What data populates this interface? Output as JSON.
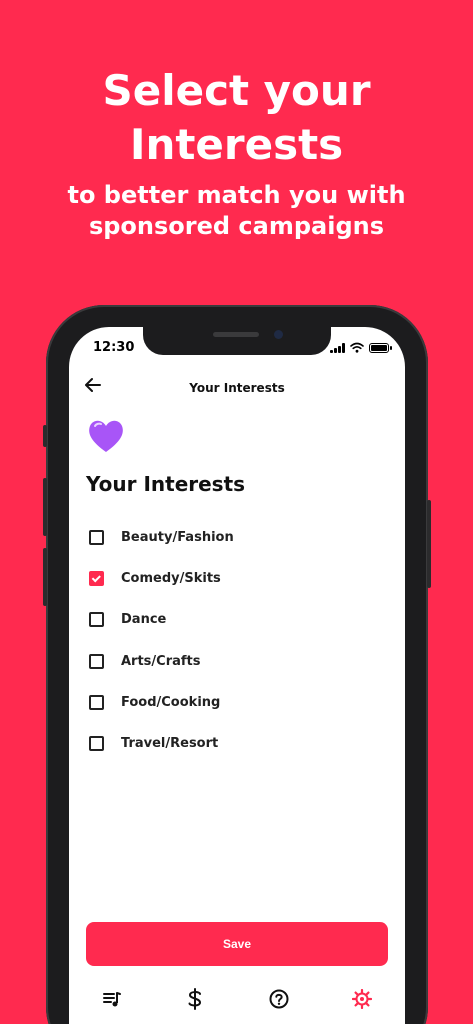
{
  "promo": {
    "title_line1": "Select your",
    "title_line2": "Interests",
    "subtitle_line1": "to better match you with",
    "subtitle_line2": "sponsored campaigns"
  },
  "status_bar": {
    "time": "12:30"
  },
  "nav": {
    "back_icon": "arrow-left-icon",
    "title": "Your Interests"
  },
  "heart_icon": "purple-heart-icon",
  "section_title": "Your Interests",
  "interests": [
    {
      "label": "Beauty/Fashion",
      "checked": false
    },
    {
      "label": "Comedy/Skits",
      "checked": true
    },
    {
      "label": "Dance",
      "checked": false
    },
    {
      "label": "Arts/Crafts",
      "checked": false
    },
    {
      "label": "Food/Cooking",
      "checked": false
    },
    {
      "label": "Travel/Resort",
      "checked": false
    }
  ],
  "save_label": "Save",
  "tabs": [
    {
      "icon": "playlist-icon",
      "active": false
    },
    {
      "icon": "dollar-icon",
      "active": false
    },
    {
      "icon": "help-circle-icon",
      "active": false
    },
    {
      "icon": "gear-icon",
      "active": true
    }
  ],
  "colors": {
    "accent": "#FF2A4F",
    "text": "#222222",
    "heart": "#A855F7"
  }
}
